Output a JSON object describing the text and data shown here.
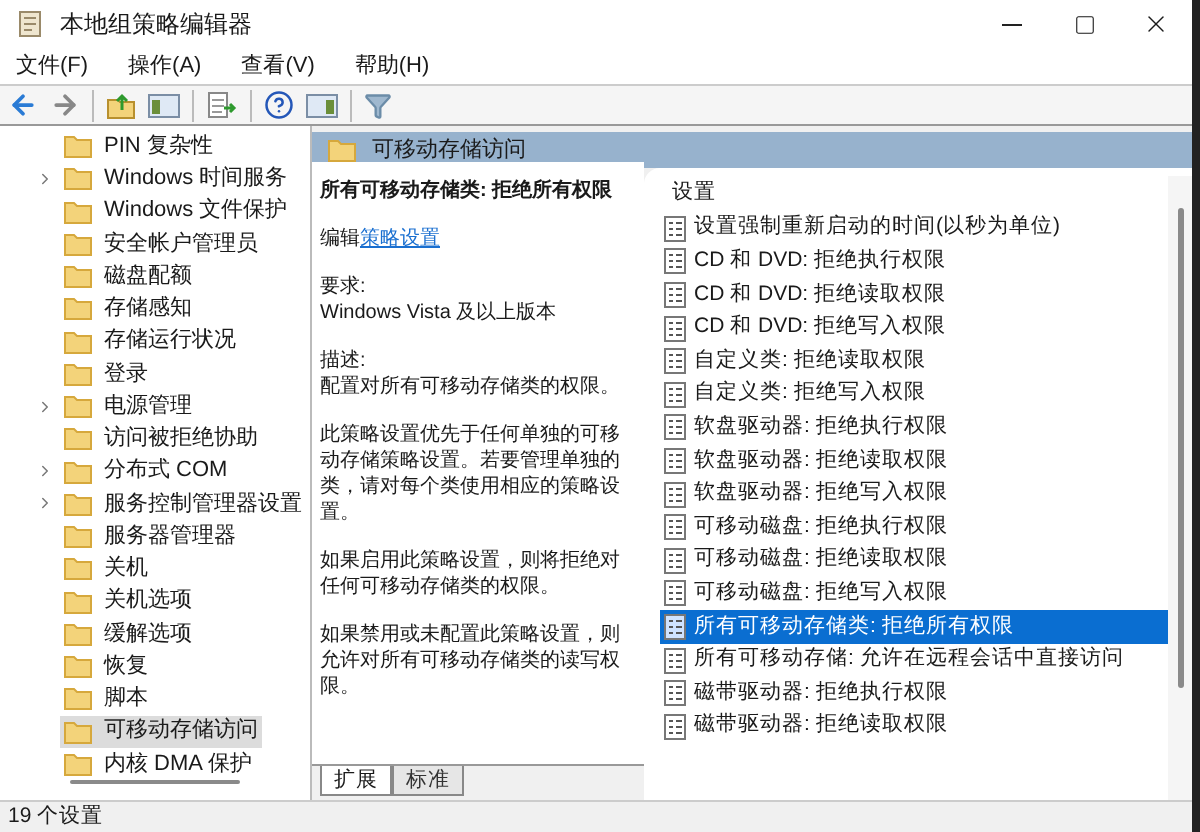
{
  "window": {
    "title": "本地组策略编辑器"
  },
  "menu": [
    "文件(F)",
    "操作(A)",
    "查看(V)",
    "帮助(H)"
  ],
  "tree": [
    {
      "label": "PIN 复杂性",
      "expandable": false,
      "selected": false
    },
    {
      "label": "Windows 时间服务",
      "expandable": true,
      "selected": false
    },
    {
      "label": "Windows 文件保护",
      "expandable": false,
      "selected": false
    },
    {
      "label": "安全帐户管理员",
      "expandable": false,
      "selected": false
    },
    {
      "label": "磁盘配额",
      "expandable": false,
      "selected": false
    },
    {
      "label": "存储感知",
      "expandable": false,
      "selected": false
    },
    {
      "label": "存储运行状况",
      "expandable": false,
      "selected": false
    },
    {
      "label": "登录",
      "expandable": false,
      "selected": false
    },
    {
      "label": "电源管理",
      "expandable": true,
      "selected": false
    },
    {
      "label": "访问被拒绝协助",
      "expandable": false,
      "selected": false
    },
    {
      "label": "分布式 COM",
      "expandable": true,
      "selected": false
    },
    {
      "label": "服务控制管理器设置",
      "expandable": true,
      "selected": false
    },
    {
      "label": "服务器管理器",
      "expandable": false,
      "selected": false
    },
    {
      "label": "关机",
      "expandable": false,
      "selected": false
    },
    {
      "label": "关机选项",
      "expandable": false,
      "selected": false
    },
    {
      "label": "缓解选项",
      "expandable": false,
      "selected": false
    },
    {
      "label": "恢复",
      "expandable": false,
      "selected": false
    },
    {
      "label": "脚本",
      "expandable": false,
      "selected": false
    },
    {
      "label": "可移动存储访问",
      "expandable": false,
      "selected": true
    },
    {
      "label": "内核 DMA 保护",
      "expandable": false,
      "selected": false
    }
  ],
  "header": {
    "title": "可移动存储访问"
  },
  "description": {
    "title": "所有可移动存储类: 拒绝所有权限",
    "edit_prefix": "编辑",
    "edit_link": "策略设置",
    "requirements_label": "要求:",
    "requirements": "Windows Vista 及以上版本",
    "description_label": "描述:",
    "paragraphs": [
      "配置对所有可移动存储类的权限。",
      "此策略设置优先于任何单独的可移动存储策略设置。若要管理单独的类，请对每个类使用相应的策略设置。",
      "如果启用此策略设置，则将拒绝对任何可移动存储类的权限。",
      "如果禁用或未配置此策略设置，则允许对所有可移动存储类的读写权限。"
    ]
  },
  "tabs": [
    {
      "label": "扩展",
      "selected": true
    },
    {
      "label": "标准",
      "selected": false
    }
  ],
  "settings": {
    "column": "设置",
    "rows": [
      {
        "label": "设置强制重新启动的时间(以秒为单位)",
        "selected": false
      },
      {
        "label": "CD 和 DVD: 拒绝执行权限",
        "selected": false
      },
      {
        "label": "CD 和 DVD: 拒绝读取权限",
        "selected": false
      },
      {
        "label": "CD 和 DVD: 拒绝写入权限",
        "selected": false
      },
      {
        "label": "自定义类: 拒绝读取权限",
        "selected": false
      },
      {
        "label": "自定义类: 拒绝写入权限",
        "selected": false
      },
      {
        "label": "软盘驱动器: 拒绝执行权限",
        "selected": false
      },
      {
        "label": "软盘驱动器: 拒绝读取权限",
        "selected": false
      },
      {
        "label": "软盘驱动器: 拒绝写入权限",
        "selected": false
      },
      {
        "label": "可移动磁盘: 拒绝执行权限",
        "selected": false
      },
      {
        "label": "可移动磁盘: 拒绝读取权限",
        "selected": false
      },
      {
        "label": "可移动磁盘: 拒绝写入权限",
        "selected": false
      },
      {
        "label": "所有可移动存储类: 拒绝所有权限",
        "selected": true
      },
      {
        "label": "所有可移动存储: 允许在远程会话中直接访问",
        "selected": false
      },
      {
        "label": "磁带驱动器: 拒绝执行权限",
        "selected": false
      },
      {
        "label": "磁带驱动器: 拒绝读取权限",
        "selected": false
      }
    ]
  },
  "status_bar": "19 个设置"
}
